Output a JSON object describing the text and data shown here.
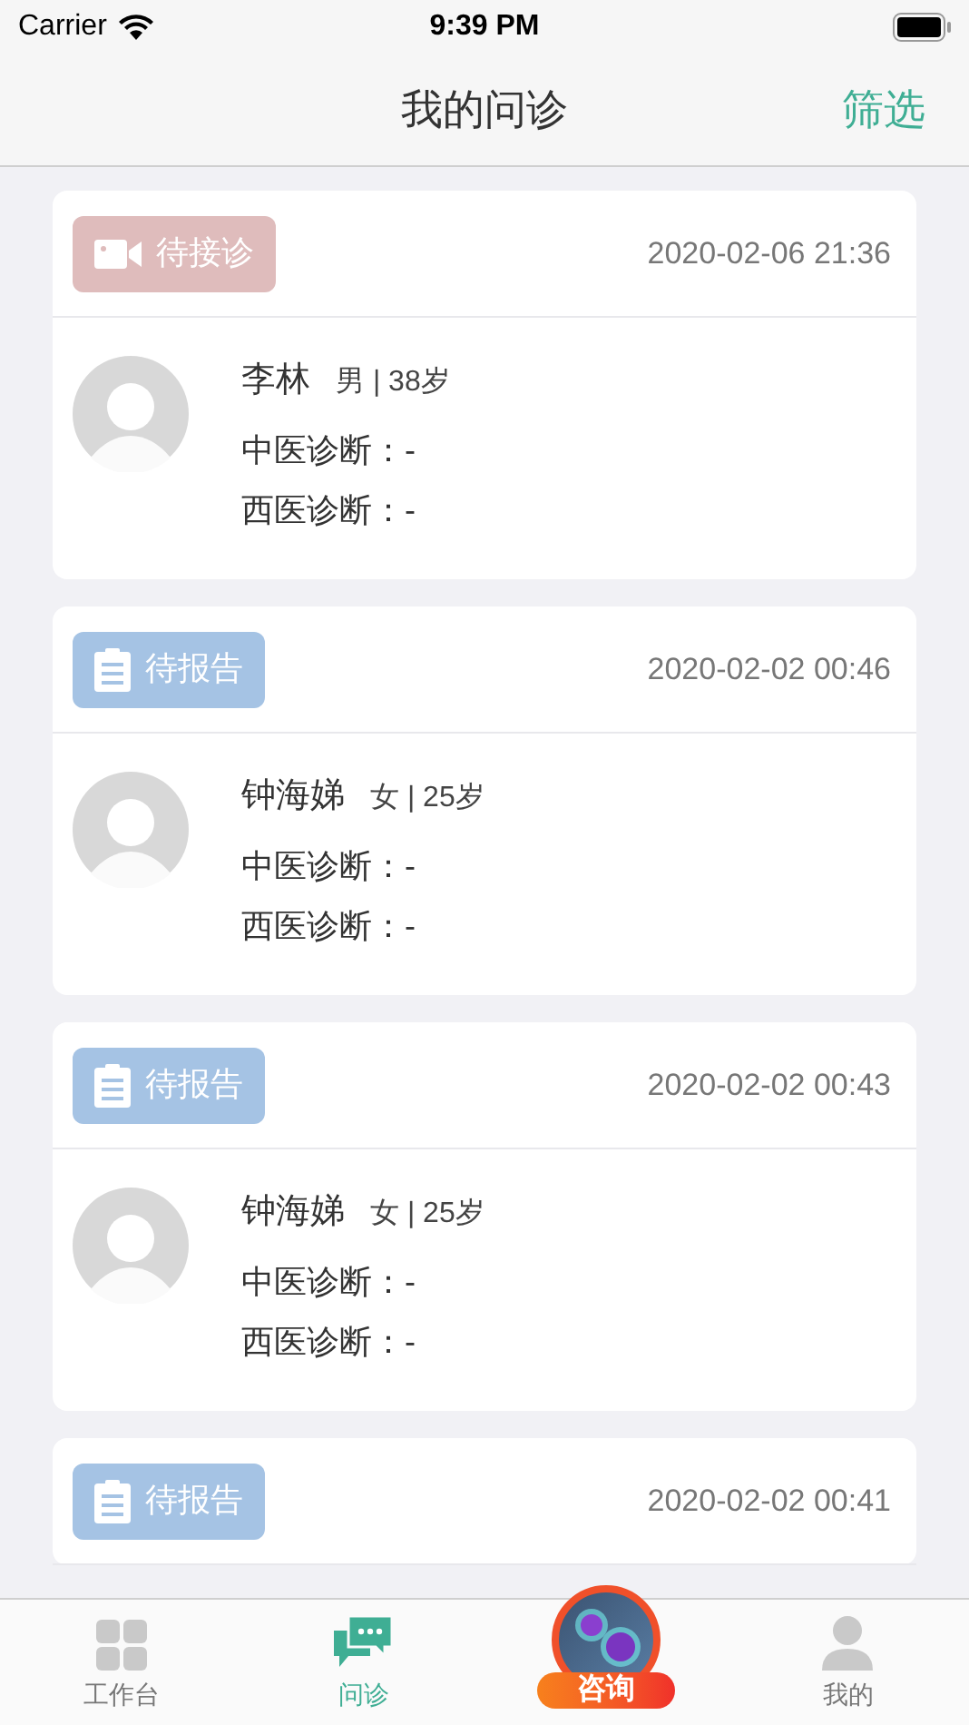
{
  "status_bar": {
    "carrier": "Carrier",
    "time": "9:39 PM"
  },
  "nav": {
    "title": "我的问诊",
    "action": "筛选"
  },
  "consultations": [
    {
      "status": {
        "kind": "video",
        "label": "待接诊"
      },
      "time": "2020-02-06 21:36",
      "patient": {
        "name": "李林",
        "info": "男 | 38岁",
        "tcm": "中医诊断：-",
        "western": "西医诊断：-"
      }
    },
    {
      "status": {
        "kind": "report",
        "label": "待报告"
      },
      "time": "2020-02-02 00:46",
      "patient": {
        "name": "钟海娣",
        "info": "女 | 25岁",
        "tcm": "中医诊断：-",
        "western": "西医诊断：-"
      }
    },
    {
      "status": {
        "kind": "report",
        "label": "待报告"
      },
      "time": "2020-02-02 00:43",
      "patient": {
        "name": "钟海娣",
        "info": "女 | 25岁",
        "tcm": "中医诊断：-",
        "western": "西医诊断：-"
      }
    },
    {
      "status": {
        "kind": "report",
        "label": "待报告"
      },
      "time": "2020-02-02 00:41"
    }
  ],
  "tab_bar": [
    {
      "kind": "grid",
      "label": "工作台",
      "selected": false
    },
    {
      "kind": "chat",
      "label": "问诊",
      "selected": true
    },
    {
      "kind": "special",
      "label": "咨询",
      "selected": false
    },
    {
      "kind": "person",
      "label": "我的",
      "selected": false
    }
  ]
}
